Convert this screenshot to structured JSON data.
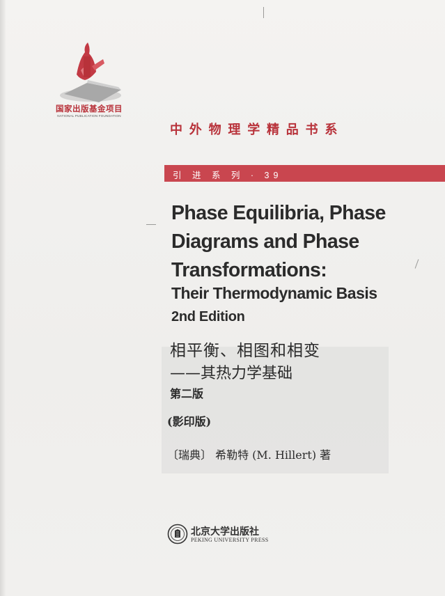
{
  "emblem": {
    "name_cn": "国家出版基金项目",
    "name_en": "NATIONAL PUBLICATION FOUNDATION",
    "primary_color": "#b8323a",
    "icon": "publication-foundation-emblem-icon"
  },
  "series": {
    "title": "中外物理学精品书系",
    "band_label": "引 进 系 列 · 39",
    "band_color": "#c9464f"
  },
  "title_en": {
    "line1": "Phase Equilibria, Phase",
    "line2": "Diagrams and Phase",
    "line3": "Transformations:",
    "subtitle": "Their Thermodynamic Basis",
    "edition": "2nd Edition"
  },
  "title_cn": {
    "title": "相平衡、相图和相变",
    "subtitle": "——其热力学基础",
    "edition": "第二版",
    "facsimile": "(影印版)"
  },
  "author": {
    "line": "〔瑞典〕 希勒特 (M. Hillert) 著"
  },
  "publisher": {
    "name_cn": "北京大学出版社",
    "name_en": "PEKING UNIVERSITY PRESS",
    "icon": "peking-university-seal-icon"
  }
}
